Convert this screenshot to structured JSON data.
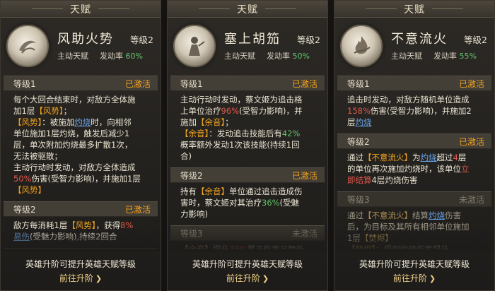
{
  "cards": [
    {
      "title": "天赋",
      "name": "风助火势",
      "level": "等级2",
      "type": "主动天赋",
      "trigger_label": "发动率",
      "trigger_rate": "60%",
      "levels": [
        {
          "label": "等级1",
          "status": "已激活",
          "lines": [
            [
              {
                "t": "每个大回合结束时，对敌方全体施"
              }
            ],
            [
              {
                "t": "加1层"
              },
              {
                "t": "【风势】",
                "c": "kw"
              },
              {
                "t": "；"
              }
            ],
            [
              {
                "t": "【风势】",
                "c": "kw"
              },
              {
                "t": "：被施加"
              },
              {
                "t": "灼烧",
                "c": "link"
              },
              {
                "t": "时，向相邻"
              }
            ],
            [
              {
                "t": "单位施加1层灼烧，触发后减少1"
              }
            ],
            [
              {
                "t": "层，单次附加灼烧最多扩散1次，"
              }
            ],
            [
              {
                "t": "无法被驱散；"
              }
            ],
            [
              {
                "t": "主动行动时发动，对敌方全体造成"
              }
            ],
            [
              {
                "t": "50%",
                "c": "red"
              },
              {
                "t": "伤害(受智力影响)，并施加1层"
              }
            ],
            [
              {
                "t": "【风势】",
                "c": "kw"
              }
            ]
          ]
        },
        {
          "label": "等级2",
          "status": "已激活",
          "lines": [
            [
              {
                "t": "敌方每消耗1层"
              },
              {
                "t": "【风势】",
                "c": "kw"
              },
              {
                "t": "，获得"
              },
              {
                "t": "8%",
                "c": "red"
              }
            ],
            [
              {
                "t": "易伤",
                "c": "link"
              },
              {
                "t": "(受魅力影响),持续2回合"
              }
            ]
          ]
        },
        {
          "label": "等级3",
          "status": "未激活",
          "lines": []
        }
      ],
      "footer_note": "英雄升阶可提升英雄天赋等级",
      "go_label": "前往升阶"
    },
    {
      "title": "天赋",
      "name": "塞上胡笳",
      "level": "等级2",
      "type": "主动天赋",
      "trigger_label": "发动率",
      "trigger_rate": "50%",
      "levels": [
        {
          "label": "等级1",
          "status": "已激活",
          "lines": [
            [
              {
                "t": "主动行动时发动，蔡文姬为追击格"
              }
            ],
            [
              {
                "t": "上单位治疗"
              },
              {
                "t": "96%",
                "c": "red"
              },
              {
                "t": "(受智力影响)，并"
              }
            ],
            [
              {
                "t": "施加"
              },
              {
                "t": "【余音】",
                "c": "kw"
              },
              {
                "t": "；"
              }
            ],
            [
              {
                "t": "【余音】",
                "c": "kw"
              },
              {
                "t": "：发动追击技能后有"
              },
              {
                "t": "42%",
                "c": "grn"
              }
            ],
            [
              {
                "t": "概率额外发动1次该技能(持续1回"
              }
            ],
            [
              {
                "t": "合)"
              }
            ]
          ]
        },
        {
          "label": "等级2",
          "status": "已激活",
          "lines": [
            [
              {
                "t": "持有"
              },
              {
                "t": "【余音】",
                "c": "kw"
              },
              {
                "t": "单位通过追击造成伤"
              }
            ],
            [
              {
                "t": "害时，蔡文姬对其治疗"
              },
              {
                "t": "36%",
                "c": "grn"
              },
              {
                "t": "(受魅"
              }
            ],
            [
              {
                "t": "力影响)"
              }
            ]
          ]
        },
        {
          "label": "等级3",
          "status": "未激活",
          "lines": [
            [
              {
                "t": "【余音】",
                "c": "kw"
              },
              {
                "t": "提升"
              },
              {
                "t": "36%",
                "c": "red"
              },
              {
                "t": "暴击伤害且额外"
              }
            ]
          ]
        }
      ],
      "footer_note": "英雄升阶可提升英雄天赋等级",
      "go_label": "前往升阶"
    },
    {
      "title": "天赋",
      "name": "不意流火",
      "level": "等级2",
      "type": "主动天赋",
      "trigger_label": "发动率",
      "trigger_rate": "55%",
      "levels": [
        {
          "label": "等级1",
          "status": "已激活",
          "lines": [
            [
              {
                "t": "追击时发动，对敌方随机单位造成"
              }
            ],
            [
              {
                "t": "158%",
                "c": "red"
              },
              {
                "t": "伤害(受智力影响)，并施加2"
              }
            ],
            [
              {
                "t": "层"
              },
              {
                "t": "灼烧",
                "c": "link"
              }
            ]
          ]
        },
        {
          "label": "等级2",
          "status": "已激活",
          "lines": [
            [
              {
                "t": "通过"
              },
              {
                "t": "【不意流火】",
                "c": "kw"
              },
              {
                "t": "为"
              },
              {
                "t": "灼烧",
                "c": "link"
              },
              {
                "t": "超过"
              },
              {
                "t": "4",
                "c": "red"
              },
              {
                "t": "层"
              }
            ],
            [
              {
                "t": "的单位再次施加灼烧时，该单位"
              },
              {
                "t": "立",
                "c": "red"
              }
            ],
            [
              {
                "t": "即结算",
                "c": "red"
              },
              {
                "t": "4层灼烧伤害"
              }
            ]
          ]
        },
        {
          "label": "等级3",
          "status": "未激活",
          "lines": [
            [
              {
                "t": "通过"
              },
              {
                "t": "【不意流火】",
                "c": "kw"
              },
              {
                "t": "结算"
              },
              {
                "t": "灼烧",
                "c": "link"
              },
              {
                "t": "伤害"
              }
            ],
            [
              {
                "t": "后，为目标及其所有相邻单位施加"
              }
            ],
            [
              {
                "t": "1层"
              },
              {
                "t": "【焚烬】",
                "c": "kw"
              }
            ],
            [
              {
                "t": "【焚烬】",
                "c": "kw"
              },
              {
                "t": "：受到灼烧伤害提升"
              }
            ]
          ]
        }
      ],
      "footer_note": "英雄升阶可提升英雄天赋等级",
      "go_label": "前往升阶"
    }
  ]
}
